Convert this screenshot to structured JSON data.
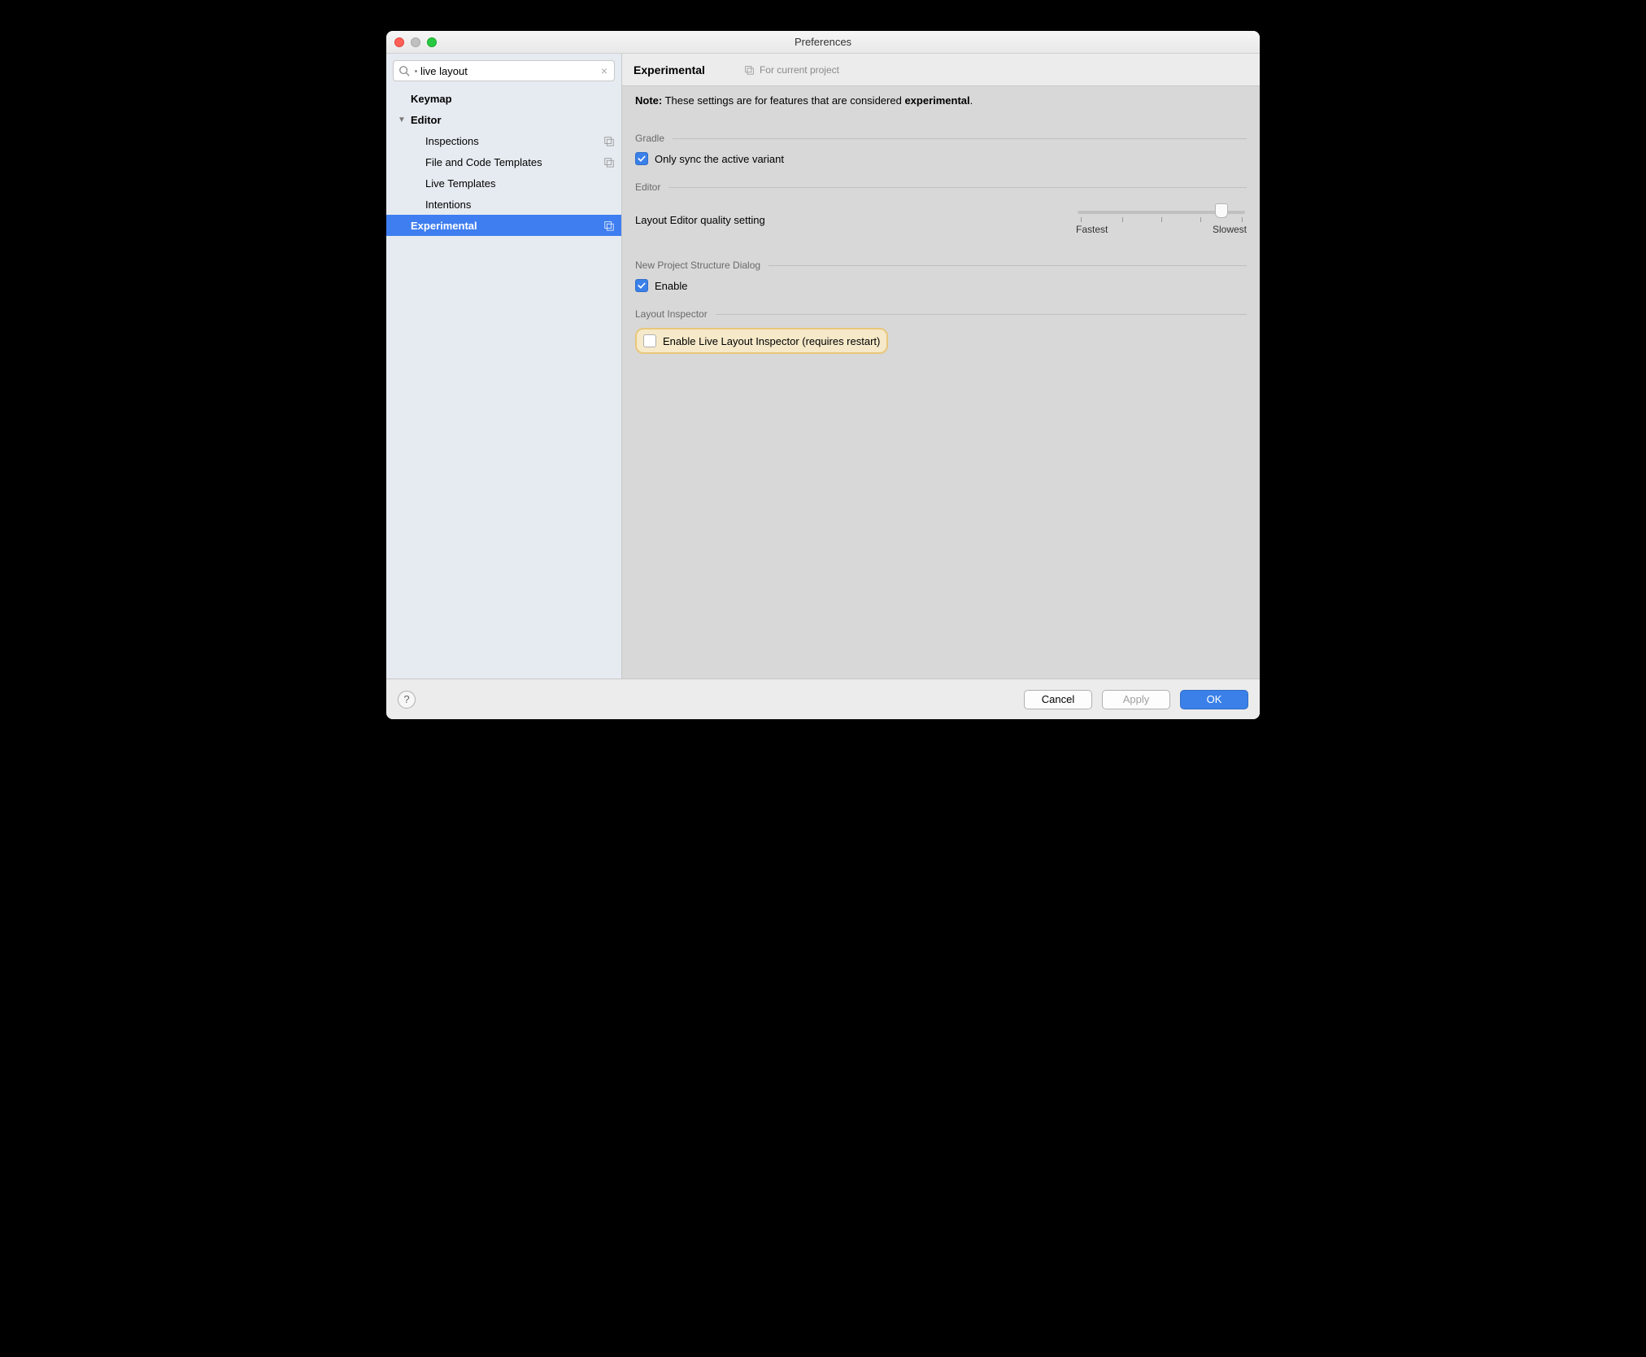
{
  "title": "Preferences",
  "search": {
    "value": "live layout"
  },
  "sidebar": {
    "items": [
      {
        "label": "Keymap",
        "bold": true
      },
      {
        "label": "Editor",
        "bold": true,
        "expandable": true
      },
      {
        "label": "Inspections",
        "child": true,
        "badge": true
      },
      {
        "label": "File and Code Templates",
        "child": true,
        "badge": true
      },
      {
        "label": "Live Templates",
        "child": true
      },
      {
        "label": "Intentions",
        "child": true
      },
      {
        "label": "Experimental",
        "bold": true,
        "selected": true,
        "badge": true
      }
    ]
  },
  "header": {
    "title": "Experimental",
    "scope": "For current project"
  },
  "note": {
    "prefix": "Note:",
    "middle": " These settings are for features that are considered ",
    "emph": "experimental",
    "suffix": "."
  },
  "sections": {
    "gradle": {
      "label": "Gradle",
      "sync_label": "Only sync the active variant",
      "sync_checked": true
    },
    "editor": {
      "label": "Editor",
      "quality_label": "Layout Editor quality setting",
      "fastest": "Fastest",
      "slowest": "Slowest"
    },
    "nps": {
      "label": "New Project Structure Dialog",
      "enable_label": "Enable",
      "enable_checked": true
    },
    "inspector": {
      "label": "Layout Inspector",
      "enable_label": "Enable Live Layout Inspector (requires restart)",
      "enable_checked": false
    }
  },
  "footer": {
    "cancel": "Cancel",
    "apply": "Apply",
    "ok": "OK"
  }
}
